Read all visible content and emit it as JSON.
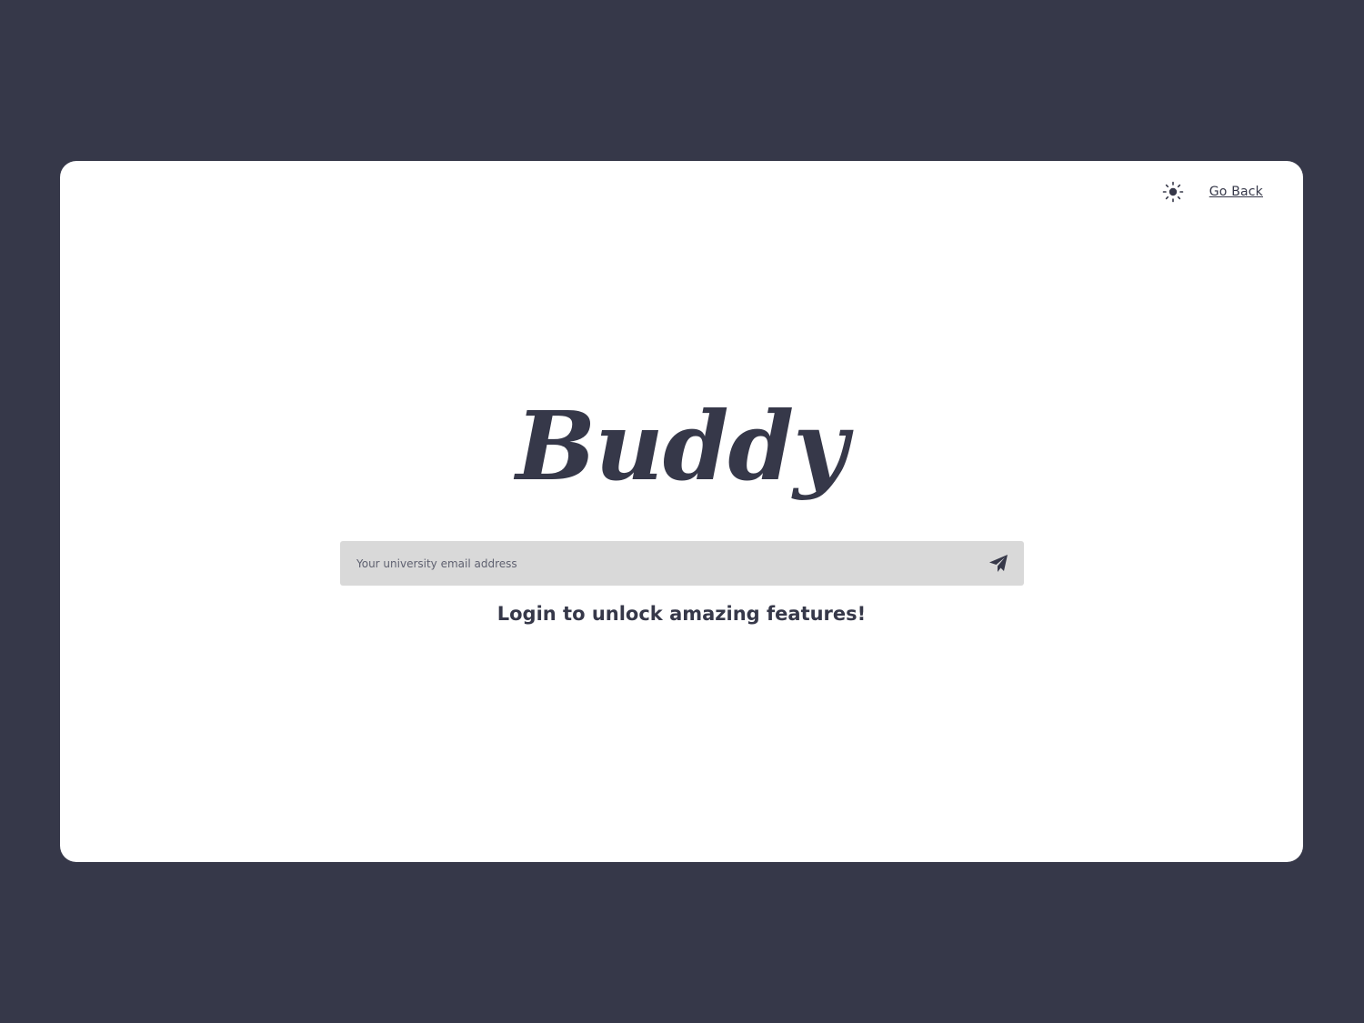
{
  "header": {
    "theme_toggle_icon": "sun-icon",
    "go_back_label": "Go Back"
  },
  "brand": {
    "logo_text": "Buddy"
  },
  "login": {
    "email_placeholder": "Your university email address",
    "email_value": "",
    "send_icon": "paper-plane-icon",
    "tagline": "Login to unlock amazing features!"
  },
  "colors": {
    "background": "#363849",
    "card": "#ffffff",
    "text": "#363849",
    "input_bg": "#d9d9d9"
  }
}
